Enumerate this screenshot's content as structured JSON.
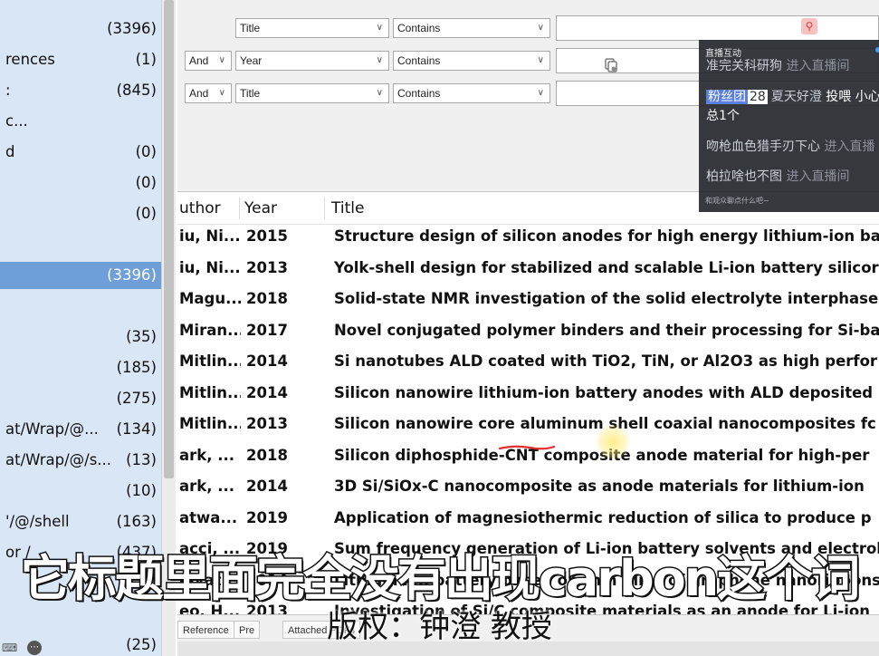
{
  "sidebar": {
    "rows": [
      {
        "label": "",
        "count": "(3396)"
      },
      {
        "label": "rences",
        "count": "(1)"
      },
      {
        "label": ":",
        "count": "(845)"
      },
      {
        "label": "c...",
        "count": ""
      },
      {
        "label": "d",
        "count": "(0)"
      },
      {
        "label": "",
        "count": "(0)"
      },
      {
        "label": "",
        "count": "(0)"
      },
      {
        "label": "",
        "count": ""
      },
      {
        "label": "",
        "count": "(3396)",
        "selected": true
      },
      {
        "label": "",
        "count": ""
      },
      {
        "label": "",
        "count": "(35)"
      },
      {
        "label": "",
        "count": "(185)"
      },
      {
        "label": "",
        "count": "(275)"
      },
      {
        "label": "at/Wrap/@...",
        "count": "(134)"
      },
      {
        "label": "at/Wrap/@/s...",
        "count": "(13)"
      },
      {
        "label": "",
        "count": "(10)"
      },
      {
        "label": "'/@/shell",
        "count": "(163)"
      },
      {
        "label": "or /",
        "count": "(437)"
      },
      {
        "label": "",
        "count": ""
      },
      {
        "label": "",
        "count": ""
      },
      {
        "label": "",
        "count": "(25)"
      }
    ]
  },
  "search": {
    "rows": [
      {
        "connector": "",
        "field": "Title",
        "operator": "Contains"
      },
      {
        "connector": "And",
        "field": "Year",
        "operator": "Contains"
      },
      {
        "connector": "And",
        "field": "Title",
        "operator": "Contains"
      }
    ]
  },
  "live_chat": {
    "title": "直播互动",
    "messages": [
      {
        "user": "准完关科研狗",
        "note": "进入直播间"
      },
      {
        "badge": "粉丝团",
        "level": "28",
        "user": "夏天好澄",
        "text": "投喂 小心"
      },
      {
        "text": "总1个"
      },
      {
        "user": "吻枪血色猎手刃下心",
        "note": "进入直播"
      },
      {
        "user": "柏拉啥也不图",
        "note": "进入直播间"
      }
    ],
    "hint": "和观众聊点什么吧~"
  },
  "table": {
    "columns": {
      "author": "uthor",
      "year": "Year",
      "title": "Title"
    },
    "rows": [
      {
        "author": "iu, Ni...",
        "year": "2015",
        "title": "Structure design of silicon anodes for high energy lithium-ion ba"
      },
      {
        "author": "iu, Ni...",
        "year": "2013",
        "title": "Yolk-shell design for stabilized and scalable Li-ion battery silicor"
      },
      {
        "author": "Magu...",
        "year": "2018",
        "title": "Solid-state NMR investigation of the solid electrolyte interphase"
      },
      {
        "author": "Miran...",
        "year": "2017",
        "title": "Novel conjugated polymer binders and their processing for Si-ba"
      },
      {
        "author": "Mitlin...",
        "year": "2014",
        "title": "Si nanotubes ALD coated with TiO2, TiN, or Al2O3 as high perfor"
      },
      {
        "author": "Mitlin...",
        "year": "2014",
        "title": "Silicon nanowire lithium-ion battery anodes with ALD deposited"
      },
      {
        "author": "Mitlin...",
        "year": "2013",
        "title": "Silicon nanowire core aluminum shell coaxial nanocomposites fc"
      },
      {
        "author": "ark, ...",
        "year": "2018",
        "title": "Silicon diphosphide-CNT composite anode material for high-per"
      },
      {
        "author": "ark, ...",
        "year": "2014",
        "title": "3D Si/SiOx-C nanocomposite as anode materials for lithium-ion"
      },
      {
        "author": "atwa...",
        "year": "2019",
        "title": "Application of magnesiothermic reduction of silica to produce p"
      },
      {
        "author": "acci, ...",
        "year": "2019",
        "title": "Sum frequency generation of Li-ion battery solvents and electrol"
      },
      {
        "author": "alvat...",
        "year": "2014",
        "title": "Lithium ion battery based on thin films of graphene nanoribbons"
      },
      {
        "author": "eo, H...",
        "year": "2013",
        "title": "Investigation of Si/C composite materials as an anode for Li-ion"
      }
    ]
  },
  "bottom_tabs": [
    "Reference",
    "Pre",
    "Attached PDFs"
  ],
  "subtitles": {
    "main": "它标题里面完全没有出现carbon这个词",
    "copyright": "版权：钟澄 教授"
  }
}
